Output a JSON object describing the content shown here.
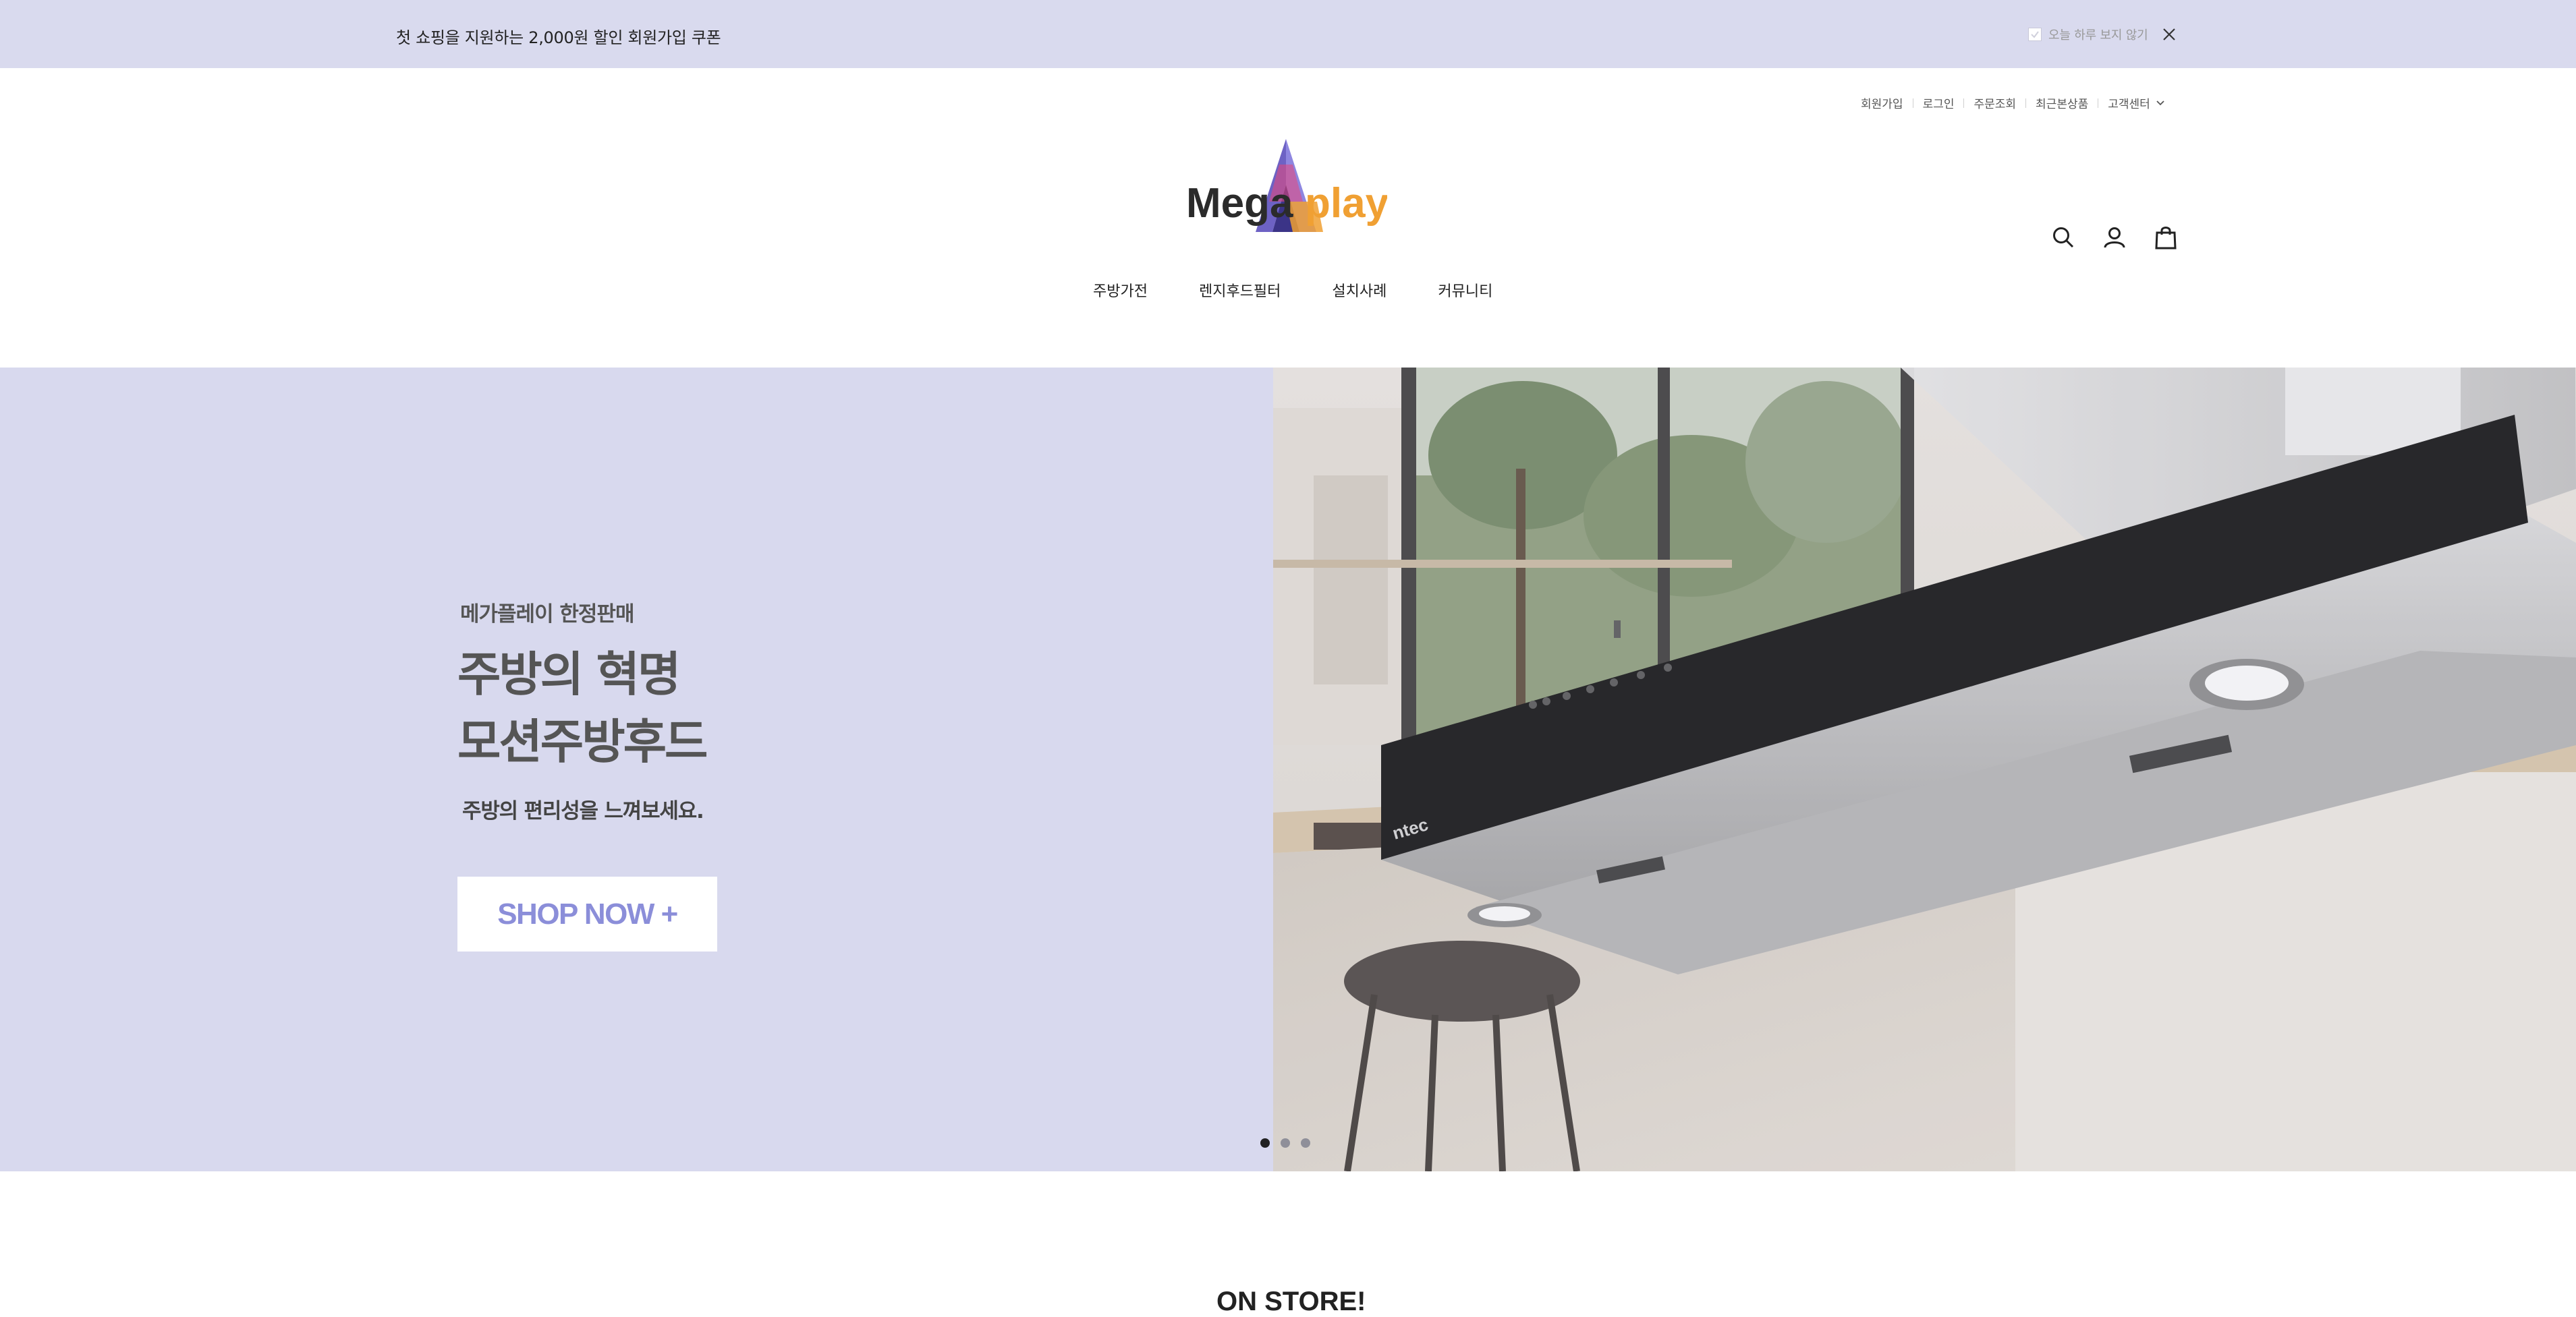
{
  "promo": {
    "text": "첫 쇼핑을 지원하는 2,000원 할인 회원가입 쿠폰",
    "dismiss_label": "오늘 하루 보지 않기"
  },
  "util_nav": {
    "items": [
      "회원가입",
      "로그인",
      "주문조회",
      "최근본상품",
      "고객센터"
    ]
  },
  "logo": {
    "part1": "Mega",
    "part2": "play"
  },
  "main_nav": {
    "items": [
      "주방가전",
      "렌지후드필터",
      "설치사례",
      "커뮤니티"
    ]
  },
  "hero": {
    "kicker": "메가플레이 한정판매",
    "title_line1": "주방의 혁명",
    "title_line2": "모션주방후드",
    "subtitle": "주방의 편리성을 느껴보세요.",
    "button": "SHOP NOW +",
    "hood_brand": "ntec",
    "slides_total": 3,
    "active_slide": 1
  },
  "section": {
    "title": "ON STORE!"
  },
  "colors": {
    "promo_bg": "#d9daee",
    "hero_bg": "#d8d9ee",
    "button_text": "#8b8ed9",
    "logo_dark": "#2b2b2b",
    "logo_orange": "#f0a033",
    "logo_purple": "#6d62c4"
  }
}
